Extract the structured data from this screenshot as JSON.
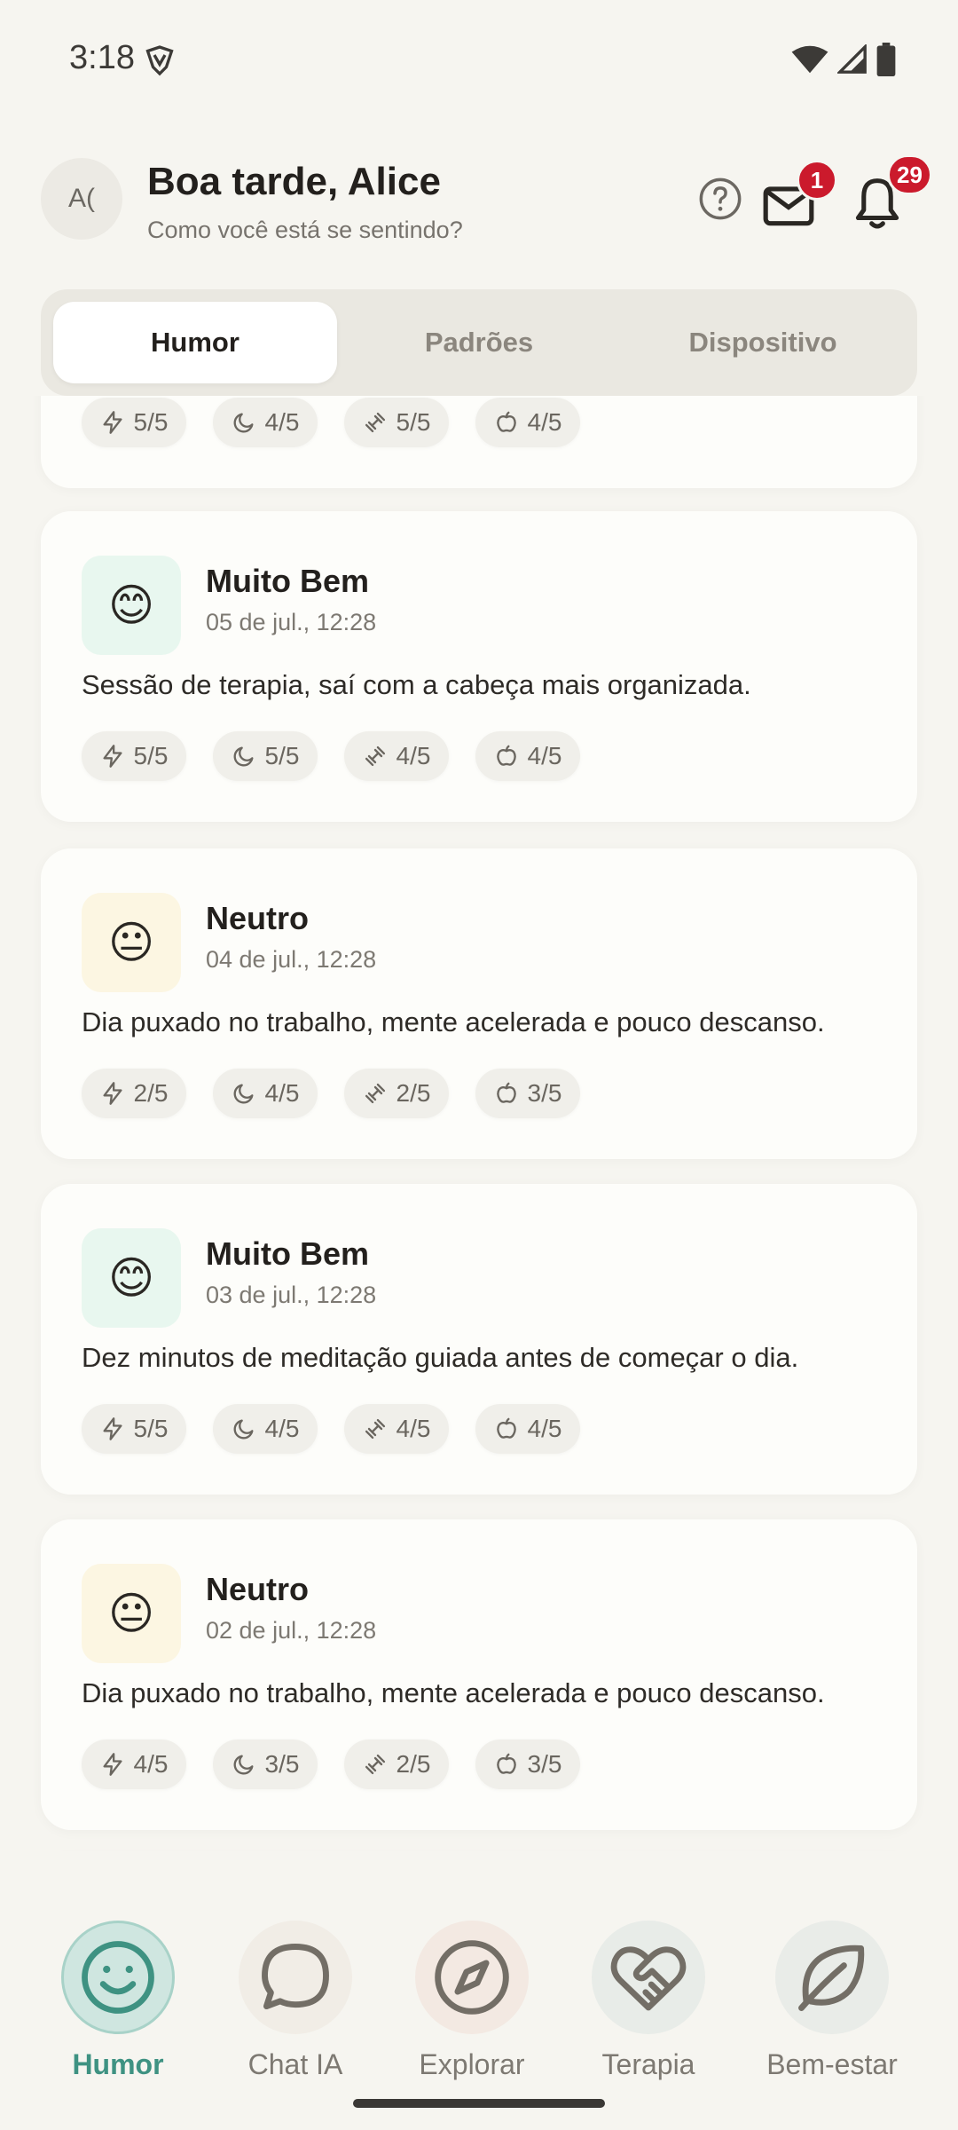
{
  "status_bar": {
    "time": "3:18"
  },
  "header": {
    "avatar_initials": "A(",
    "greeting": "Boa tarde, Alice",
    "subtitle": "Como você está se sentindo?",
    "mail_badge": "1",
    "notifications_badge": "29"
  },
  "tabs": [
    {
      "label": "Humor",
      "active": true
    },
    {
      "label": "Padrões",
      "active": false
    },
    {
      "label": "Dispositivo",
      "active": false
    }
  ],
  "partial_entry": {
    "ratings": {
      "energy": "5/5",
      "sleep": "4/5",
      "exercise": "5/5",
      "nutrition": "4/5"
    }
  },
  "entries": [
    {
      "mood": "Muito Bem",
      "emoji": "😊",
      "tile_color": "#E8F7EF",
      "date": "05 de jul., 12:28",
      "note": "Sessão de terapia, saí com a cabeça mais organizada.",
      "ratings": {
        "energy": "5/5",
        "sleep": "5/5",
        "exercise": "4/5",
        "nutrition": "4/5"
      }
    },
    {
      "mood": "Neutro",
      "emoji": "😐",
      "tile_color": "#FCF6E2",
      "date": "04 de jul., 12:28",
      "note": "Dia puxado no trabalho, mente acelerada e pouco descanso.",
      "ratings": {
        "energy": "2/5",
        "sleep": "4/5",
        "exercise": "2/5",
        "nutrition": "3/5"
      }
    },
    {
      "mood": "Muito Bem",
      "emoji": "😊",
      "tile_color": "#E8F7EF",
      "date": "03 de jul., 12:28",
      "note": "Dez minutos de meditação guiada antes de começar o dia.",
      "ratings": {
        "energy": "5/5",
        "sleep": "4/5",
        "exercise": "4/5",
        "nutrition": "4/5"
      }
    },
    {
      "mood": "Neutro",
      "emoji": "😐",
      "tile_color": "#FCF6E2",
      "date": "02 de jul., 12:28",
      "note": "Dia puxado no trabalho, mente acelerada e pouco descanso.",
      "ratings": {
        "energy": "4/5",
        "sleep": "3/5",
        "exercise": "2/5",
        "nutrition": "3/5"
      }
    }
  ],
  "bottom_nav": [
    {
      "label": "Humor",
      "icon": "smile-icon",
      "active": true
    },
    {
      "label": "Chat IA",
      "icon": "chat-bubble-icon",
      "active": false
    },
    {
      "label": "Explorar",
      "icon": "compass-icon",
      "active": false
    },
    {
      "label": "Terapia",
      "icon": "handshake-heart-icon",
      "active": false
    },
    {
      "label": "Bem-estar",
      "icon": "leaf-icon",
      "active": false
    }
  ],
  "colors": {
    "accent": "#3E9282",
    "badge": "#CB1A2C",
    "background": "#F6F5F0"
  }
}
